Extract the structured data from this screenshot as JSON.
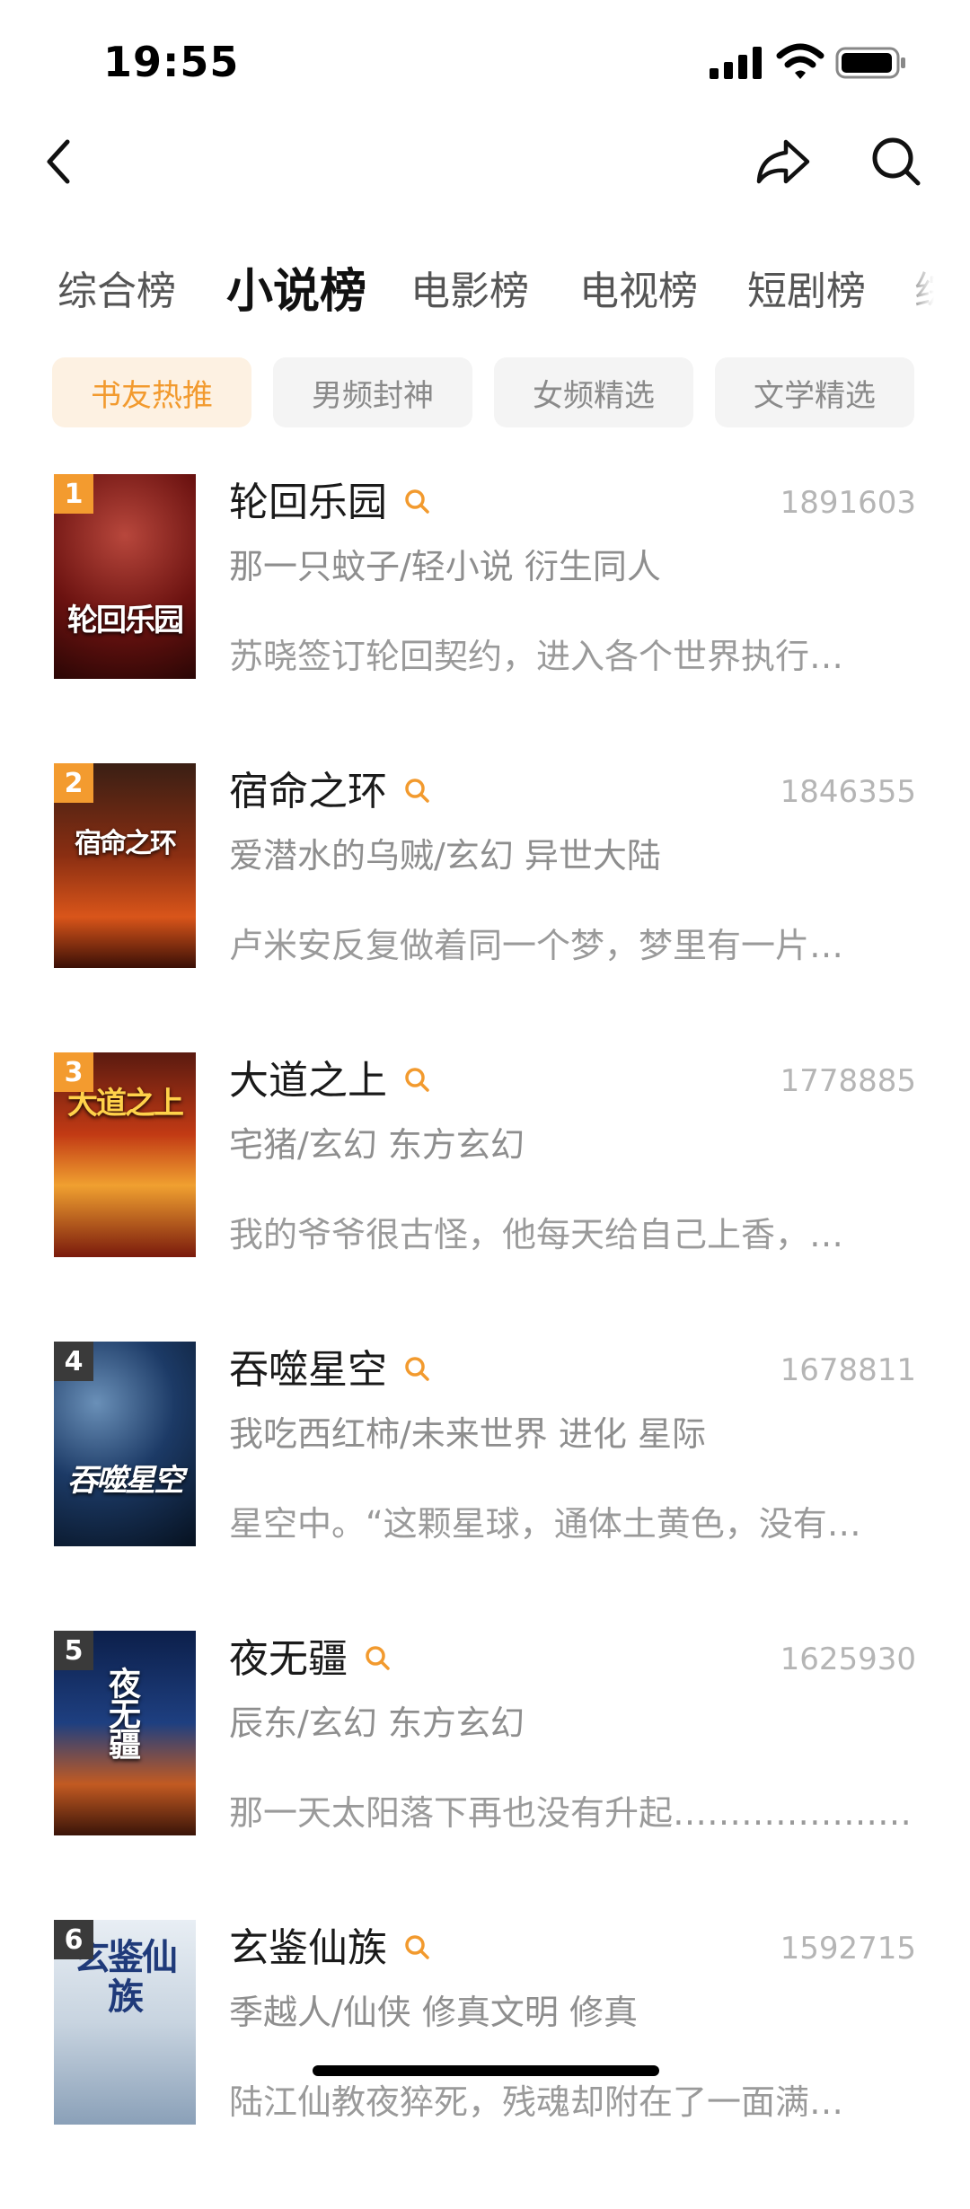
{
  "status_bar": {
    "time": "19:55"
  },
  "tabs": [
    {
      "label": "综合榜",
      "active": false
    },
    {
      "label": "小说榜",
      "active": true
    },
    {
      "label": "电影榜",
      "active": false
    },
    {
      "label": "电视榜",
      "active": false
    },
    {
      "label": "短剧榜",
      "active": false
    },
    {
      "label": "综",
      "active": false
    }
  ],
  "filters": [
    {
      "label": "书友热推",
      "active": true
    },
    {
      "label": "男频封神",
      "active": false
    },
    {
      "label": "女频精选",
      "active": false
    },
    {
      "label": "文学精选",
      "active": false
    }
  ],
  "books": [
    {
      "rank": "1",
      "title": "轮回乐园",
      "count": "1891603",
      "meta": "那一只蚊子/轻小说 衍生同人",
      "desc": "苏晓签订轮回契约，进入各个世界执行…",
      "cover_text": "轮回乐园"
    },
    {
      "rank": "2",
      "title": "宿命之环",
      "count": "1846355",
      "meta": "爱潜水的乌贼/玄幻 异世大陆",
      "desc": "卢米安反复做着同一个梦，梦里有一片…",
      "cover_text": "宿命之环"
    },
    {
      "rank": "3",
      "title": "大道之上",
      "count": "1778885",
      "meta": "宅猪/玄幻 东方玄幻",
      "desc": "我的爷爷很古怪，他每天给自己上香，…",
      "cover_text": "大道之上"
    },
    {
      "rank": "4",
      "title": "吞噬星空",
      "count": "1678811",
      "meta": "我吃西红柿/未来世界 进化 星际",
      "desc": "星空中。“这颗星球，通体土黄色，没有…",
      "cover_text": "吞噬星空"
    },
    {
      "rank": "5",
      "title": "夜无疆",
      "count": "1625930",
      "meta": "辰东/玄幻 东方玄幻",
      "desc": "那一天太阳落下再也没有升起…………………",
      "cover_text": "夜无疆"
    },
    {
      "rank": "6",
      "title": "玄鉴仙族",
      "count": "1592715",
      "meta": "季越人/仙侠 修真文明 修真",
      "desc": "陆江仙教夜猝死，残魂却附在了一面满…",
      "cover_text": "玄鉴仙族"
    }
  ],
  "colors": {
    "accent": "#f29a2e",
    "rank_top": "#f39b2f",
    "rank_other": "#3a3a3a"
  }
}
